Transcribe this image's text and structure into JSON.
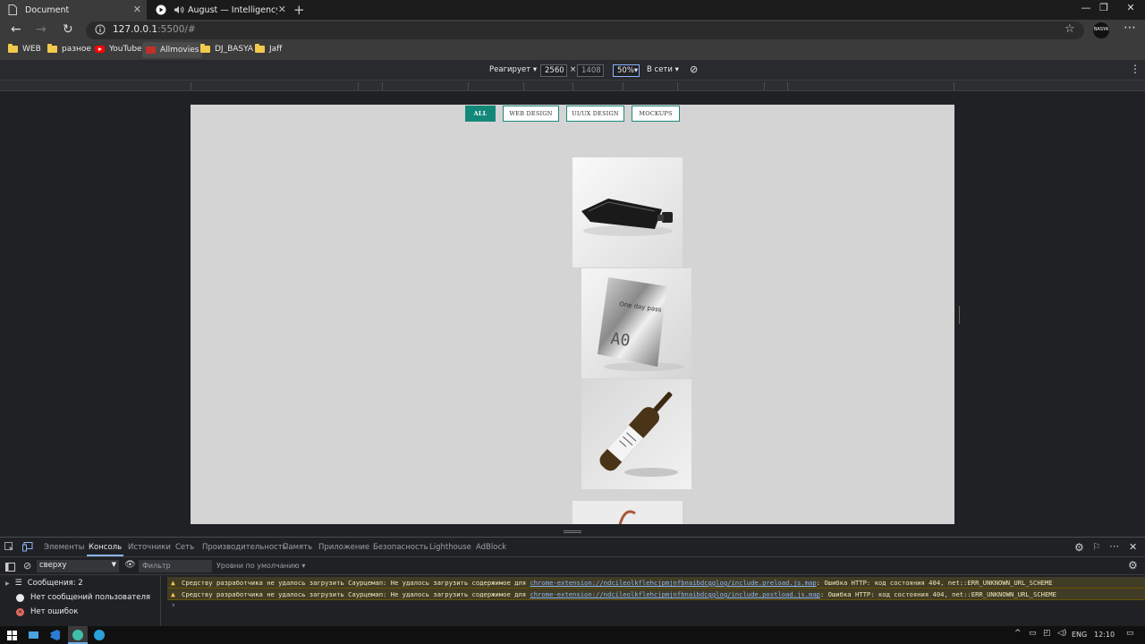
{
  "browser": {
    "tabs": [
      {
        "title": "Document"
      },
      {
        "title": "August — Intelligency, DJ D"
      }
    ],
    "url_host": "127.0.0.1",
    "url_path": ":5500/#",
    "profile_label": "BASYA",
    "bookmarks": [
      "WEB",
      "разное",
      "YouTube",
      "Allmovies",
      "DJ_BASYA",
      "Jaff"
    ]
  },
  "device_toolbar": {
    "mode": "Реагирует",
    "width": "2560",
    "height": "1408",
    "zoom": "50%",
    "network": "В сети"
  },
  "page": {
    "filters": [
      {
        "label": "ALL",
        "active": true
      },
      {
        "label": "WEB DESIGN",
        "active": false
      },
      {
        "label": "UI/UX DESIGN",
        "active": false
      },
      {
        "label": "MOCKUPS",
        "active": false
      }
    ],
    "cards": [
      {
        "icon": "black-pouch-image"
      },
      {
        "icon": "foil-bag-image",
        "print": "One day pass",
        "code": "A0"
      },
      {
        "icon": "wine-bottle-image"
      },
      {
        "icon": "partial-image"
      }
    ]
  },
  "devtools": {
    "tabs": [
      "Элементы",
      "Консоль",
      "Источники",
      "Сеть",
      "Производительность",
      "Память",
      "Приложение",
      "Безопасность",
      "Lighthouse",
      "AdBlock"
    ],
    "context": "сверху",
    "filter_placeholder": "Фильтр",
    "levels": "Уровни по умолчанию",
    "sidebar": [
      "Сообщения: 2",
      "Нет сообщений пользователя",
      "Нет ошибок"
    ],
    "warnings": [
      {
        "prefix": "Средству разработчика не удалось загрузить Саурцемап: Не удалось загрузить содержимое для ",
        "link": "chrome-extension://ndcileolkflehcjpmjnfbnaibdcgglog/include.preload.js.map",
        "suffix": ": Ошибка HTTP: код состояния 404, net::ERR_UNKNOWN_URL_SCHEME"
      },
      {
        "prefix": "Средству разработчика не удалось загрузить Саурцемап: Не удалось загрузить содержимое для ",
        "link": "chrome-extension://ndcileolkflehcjpmjnfbnaibdcgglog/include.postload.js.map",
        "suffix": ": Ошибка HTTP: код состояния 404, net::ERR_UNKNOWN_URL_SCHEME"
      }
    ]
  },
  "taskbar": {
    "lang": "ENG",
    "time": "12:10"
  },
  "colors": {
    "accent": "#12887a",
    "page_bg": "#d4d4d4"
  }
}
